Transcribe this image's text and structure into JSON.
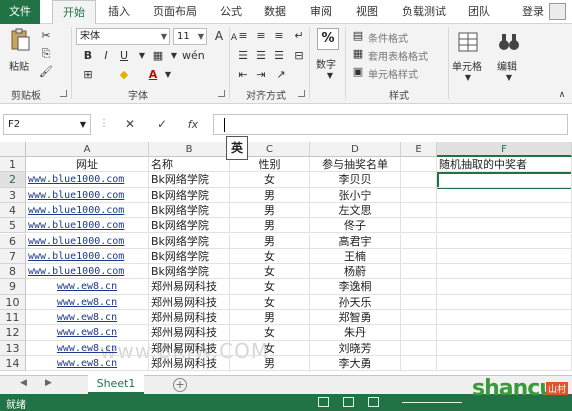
{
  "ribbon_tabs": [
    "文件",
    "开始",
    "插入",
    "页面布局",
    "公式",
    "数据",
    "审阅",
    "视图",
    "负载测试",
    "团队"
  ],
  "active_tab": "开始",
  "login_label": "登录",
  "clipboard": {
    "paste": "粘贴",
    "group": "剪贴板"
  },
  "font": {
    "name": "宋体",
    "size": "11",
    "bold": "B",
    "italic": "I",
    "underline": "U",
    "grow": "A",
    "shrink": "A",
    "group": "字体",
    "font_color": "A",
    "phonetic": "wén"
  },
  "alignment": {
    "group": "对齐方式"
  },
  "number": {
    "label": "数字",
    "symbol": "%"
  },
  "styles": {
    "conditional": "条件格式",
    "table": "套用表格格式",
    "cell": "单元格样式",
    "group": "样式"
  },
  "cells": {
    "label": "单元格"
  },
  "editing": {
    "label": "编辑"
  },
  "formula_bar": {
    "name_box": "F2",
    "fx": "fx",
    "ime": "英"
  },
  "columns": [
    "A",
    "B",
    "C",
    "D",
    "E",
    "F"
  ],
  "selected_col": "F",
  "rows": [
    {
      "n": "1",
      "a": "网址",
      "b": "名称",
      "c": "性别",
      "d": "参与抽奖名单",
      "e": "",
      "f": "随机抽取的中奖者"
    },
    {
      "n": "2",
      "a": "www.blue1000.com",
      "b": "Bk网络学院",
      "c": "女",
      "d": "李贝贝",
      "e": "",
      "f": ""
    },
    {
      "n": "3",
      "a": "www.blue1000.com",
      "b": "Bk网络学院",
      "c": "男",
      "d": "张小宁",
      "e": "",
      "f": ""
    },
    {
      "n": "4",
      "a": "www.blue1000.com",
      "b": "Bk网络学院",
      "c": "男",
      "d": "左文思",
      "e": "",
      "f": ""
    },
    {
      "n": "5",
      "a": "www.blue1000.com",
      "b": "Bk网络学院",
      "c": "男",
      "d": "佟子",
      "e": "",
      "f": ""
    },
    {
      "n": "6",
      "a": "www.blue1000.com",
      "b": "Bk网络学院",
      "c": "男",
      "d": "高君宇",
      "e": "",
      "f": ""
    },
    {
      "n": "7",
      "a": "www.blue1000.com",
      "b": "Bk网络学院",
      "c": "女",
      "d": "王楠",
      "e": "",
      "f": ""
    },
    {
      "n": "8",
      "a": "www.blue1000.com",
      "b": "Bk网络学院",
      "c": "女",
      "d": "杨蔚",
      "e": "",
      "f": ""
    },
    {
      "n": "9",
      "a": "www.ew8.cn",
      "b": "郑州易网科技",
      "c": "女",
      "d": "李逸桐",
      "e": "",
      "f": ""
    },
    {
      "n": "10",
      "a": "www.ew8.cn",
      "b": "郑州易网科技",
      "c": "女",
      "d": "孙天乐",
      "e": "",
      "f": ""
    },
    {
      "n": "11",
      "a": "www.ew8.cn",
      "b": "郑州易网科技",
      "c": "男",
      "d": "郑智勇",
      "e": "",
      "f": ""
    },
    {
      "n": "12",
      "a": "www.ew8.cn",
      "b": "郑州易网科技",
      "c": "女",
      "d": "朱丹",
      "e": "",
      "f": ""
    },
    {
      "n": "13",
      "a": "www.ew8.cn",
      "b": "郑州易网科技",
      "c": "女",
      "d": "刘晓芳",
      "e": "",
      "f": ""
    },
    {
      "n": "14",
      "a": "www.ew8.cn",
      "b": "郑州易网科技",
      "c": "男",
      "d": "李大勇",
      "e": "",
      "f": ""
    }
  ],
  "watermark_mid": "www.BKIW.COM",
  "sheet_tab": "Sheet1",
  "add_sheet": "+",
  "status": "就绪",
  "brand": {
    "main": "shancun",
    "badge": "山村"
  },
  "colors": {
    "accent": "#217346",
    "link": "#1f3a8a"
  }
}
